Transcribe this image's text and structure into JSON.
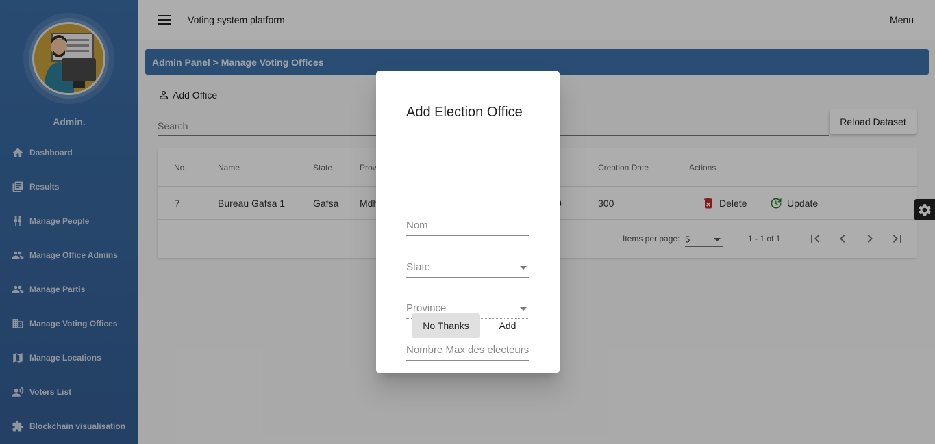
{
  "topbar": {
    "title": "Voting system platform",
    "menu_label": "Menu"
  },
  "sidebar": {
    "user_name": "Admin.",
    "items": [
      {
        "label": "Dashboard",
        "icon": "home-icon"
      },
      {
        "label": "Results",
        "icon": "list-icon"
      },
      {
        "label": "Manage People",
        "icon": "people-icon"
      },
      {
        "label": "Manage Office Admins",
        "icon": "group-icon"
      },
      {
        "label": "Manage Partis",
        "icon": "group-icon"
      },
      {
        "label": "Manage Voting Offices",
        "icon": "building-icon"
      },
      {
        "label": "Manage Locations",
        "icon": "map-icon"
      },
      {
        "label": "Voters List",
        "icon": "voice-icon"
      },
      {
        "label": "Blockchain visualisation",
        "icon": "puzzle-icon"
      }
    ]
  },
  "breadcrumb": "Admin Panel > Manage Voting Offices",
  "toolbar": {
    "add_office_label": "Add Office",
    "search_placeholder": "Search",
    "reload_label": "Reload Dataset"
  },
  "table": {
    "headers": {
      "no": "No.",
      "name": "Name",
      "state": "State",
      "province": "Prov",
      "creation": "Creation Date",
      "actions": "Actions"
    },
    "rows": [
      {
        "no": "7",
        "name": "Bureau Gafsa 1",
        "state": "Gafsa",
        "province": "Mdh",
        "max_hidden_tail": "0",
        "creation": "300",
        "delete_label": "Delete",
        "update_label": "Update"
      }
    ],
    "paginator": {
      "items_per_page_label": "Items per page:",
      "page_size": "5",
      "range_label": "1 - 1 of 1"
    }
  },
  "dialog": {
    "title": "Add Election Office",
    "fields": {
      "nom": "Nom",
      "state": "State",
      "province": "Province",
      "max_electeurs": "Nombre Max des electeurs"
    },
    "no_thanks_label": "No Thanks",
    "add_label": "Add"
  },
  "colors": {
    "sidebar": "#3c6fa8",
    "breadcrumb": "#3f72ac",
    "delete": "#c62828",
    "update": "#2e7d32"
  }
}
